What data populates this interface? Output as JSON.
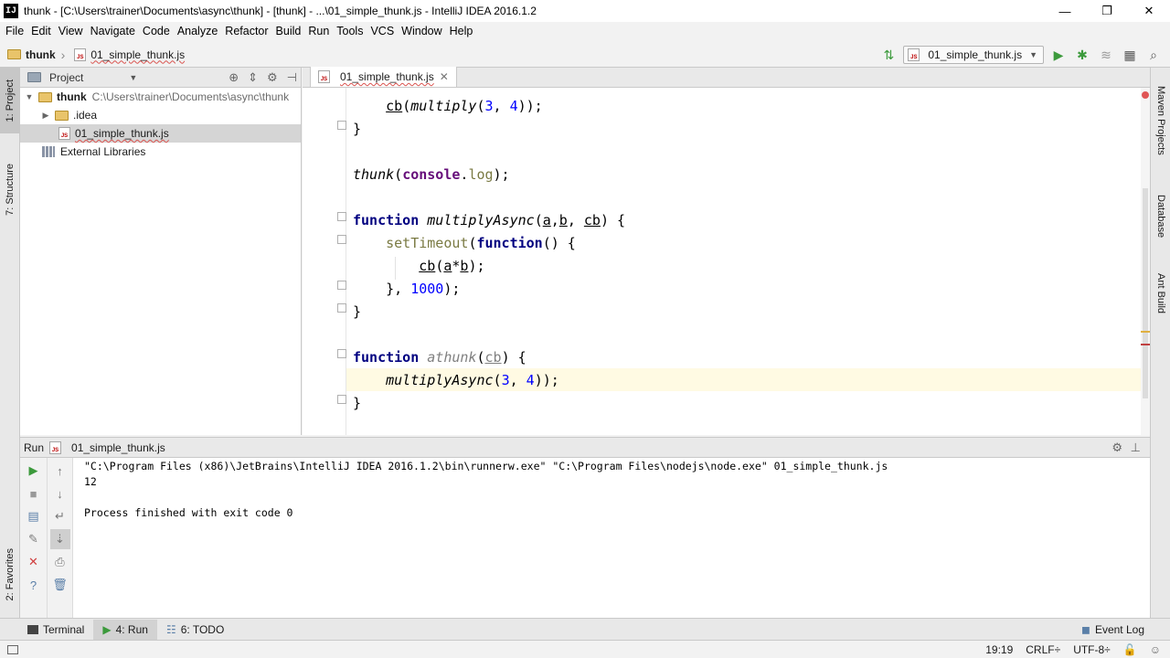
{
  "window": {
    "app_icon": "IJ",
    "title": "thunk - [C:\\Users\\trainer\\Documents\\async\\thunk] - [thunk] - ...\\01_simple_thunk.js - IntelliJ IDEA 2016.1.2",
    "minimize": "—",
    "maximize": "❐",
    "close": "✕"
  },
  "menu": [
    "File",
    "Edit",
    "View",
    "Navigate",
    "Code",
    "Analyze",
    "Refactor",
    "Build",
    "Run",
    "Tools",
    "VCS",
    "Window",
    "Help"
  ],
  "navbar": {
    "project_crumb": "thunk",
    "file_crumb": "01_simple_thunk.js",
    "run_config": "01_simple_thunk.js"
  },
  "left_stripe": {
    "project_tab": "1: Project",
    "structure_tab": "7: Structure",
    "favorites_tab": "2: Favorites"
  },
  "right_stripe": {
    "maven": "Maven Projects",
    "database": "Database",
    "ant": "Ant Build"
  },
  "project_panel": {
    "title": "Project",
    "root_name": "thunk",
    "root_path": "C:\\Users\\trainer\\Documents\\async\\thunk",
    "idea_folder": ".idea",
    "file": "01_simple_thunk.js",
    "external_libs": "External Libraries"
  },
  "editor": {
    "tab_label": "01_simple_thunk.js",
    "lines": [
      {
        "indent": "    ",
        "parts": [
          {
            "t": "cb",
            "c": "param"
          },
          {
            "t": "(",
            "c": ""
          },
          {
            "t": "multiply",
            "c": "fn-i"
          },
          {
            "t": "(",
            "c": ""
          },
          {
            "t": "3",
            "c": "num"
          },
          {
            "t": ", ",
            "c": ""
          },
          {
            "t": "4",
            "c": "num"
          },
          {
            "t": "));",
            "c": ""
          }
        ]
      },
      {
        "indent": "",
        "parts": [
          {
            "t": "}",
            "c": ""
          }
        ]
      },
      {
        "indent": "",
        "parts": []
      },
      {
        "indent": "",
        "parts": [
          {
            "t": "thunk",
            "c": "fn-i"
          },
          {
            "t": "(",
            "c": ""
          },
          {
            "t": "console",
            "c": "obj"
          },
          {
            "t": ".",
            "c": ""
          },
          {
            "t": "log",
            "c": "prop"
          },
          {
            "t": ");",
            "c": ""
          }
        ]
      },
      {
        "indent": "",
        "parts": []
      },
      {
        "indent": "",
        "parts": [
          {
            "t": "function",
            "c": "kw"
          },
          {
            "t": " ",
            "c": ""
          },
          {
            "t": "multiplyAsync",
            "c": "fn-i"
          },
          {
            "t": "(",
            "c": ""
          },
          {
            "t": "a",
            "c": "param"
          },
          {
            "t": ",",
            "c": ""
          },
          {
            "t": "b",
            "c": "param"
          },
          {
            "t": ", ",
            "c": ""
          },
          {
            "t": "cb",
            "c": "param"
          },
          {
            "t": ") {",
            "c": ""
          }
        ]
      },
      {
        "indent": "    ",
        "parts": [
          {
            "t": "setTimeout",
            "c": "prop"
          },
          {
            "t": "(",
            "c": ""
          },
          {
            "t": "function",
            "c": "kw"
          },
          {
            "t": "() {",
            "c": ""
          }
        ]
      },
      {
        "indent": "        ",
        "parts": [
          {
            "t": "cb",
            "c": "param"
          },
          {
            "t": "(",
            "c": ""
          },
          {
            "t": "a",
            "c": "param"
          },
          {
            "t": "*",
            "c": ""
          },
          {
            "t": "b",
            "c": "param"
          },
          {
            "t": ");",
            "c": ""
          }
        ]
      },
      {
        "indent": "    ",
        "parts": [
          {
            "t": "}, ",
            "c": ""
          },
          {
            "t": "1000",
            "c": "num"
          },
          {
            "t": ");",
            "c": ""
          }
        ]
      },
      {
        "indent": "",
        "parts": [
          {
            "t": "}",
            "c": ""
          }
        ]
      },
      {
        "indent": "",
        "parts": []
      },
      {
        "indent": "",
        "parts": [
          {
            "t": "function",
            "c": "kw"
          },
          {
            "t": " ",
            "c": ""
          },
          {
            "t": "athunk",
            "c": "fn-inactive"
          },
          {
            "t": "(",
            "c": ""
          },
          {
            "t": "cb",
            "c": "param gray"
          },
          {
            "t": ") {",
            "c": ""
          }
        ]
      },
      {
        "indent": "    ",
        "parts": [
          {
            "t": "multiplyAsync",
            "c": "fn-i"
          },
          {
            "t": "(",
            "c": ""
          },
          {
            "t": "3",
            "c": "num"
          },
          {
            "t": ", ",
            "c": ""
          },
          {
            "t": "4",
            "c": "num"
          },
          {
            "t": "));",
            "c": ""
          }
        ]
      },
      {
        "indent": "",
        "parts": [
          {
            "t": "}",
            "c": ""
          }
        ]
      }
    ]
  },
  "run_panel": {
    "label": "Run",
    "config": "01_simple_thunk.js",
    "console_lines": [
      "\"C:\\Program Files (x86)\\JetBrains\\IntelliJ IDEA 2016.1.2\\bin\\runnerw.exe\" \"C:\\Program Files\\nodejs\\node.exe\" 01_simple_thunk.js",
      "12",
      "",
      "Process finished with exit code 0"
    ]
  },
  "bottom_bar": {
    "terminal": "Terminal",
    "run": "4: Run",
    "todo": "6: TODO",
    "event_log": "Event Log"
  },
  "status_bar": {
    "position": "19:19",
    "line_sep": "CRLF÷",
    "encoding": "UTF-8÷"
  },
  "colors": {
    "keyword": "#000080",
    "number": "#0000ff",
    "run_green": "#3c9a3c",
    "current_line": "#fffae3"
  }
}
